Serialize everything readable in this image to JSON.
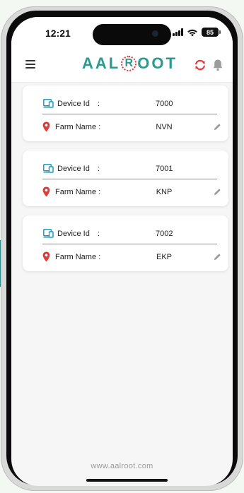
{
  "status_bar": {
    "time": "12:21",
    "battery": "85"
  },
  "header": {
    "logo_text_left": "AAL",
    "logo_ring_letter": "R",
    "logo_text_right": "OOT",
    "menu_icon": "hamburger-menu-icon",
    "refresh_icon": "refresh-icon",
    "bell_icon": "bell-icon"
  },
  "colors": {
    "brand_teal": "#2a9a8e",
    "accent_red": "#e53935",
    "pin_red": "#e53935",
    "device_icon_teal": "#1f9bbd"
  },
  "labels": {
    "device_id": "Device Id",
    "colon": ":",
    "farm_name": "Farm Name :"
  },
  "devices": [
    {
      "device_id": "7000",
      "farm_name": "NVN"
    },
    {
      "device_id": "7001",
      "farm_name": "KNP"
    },
    {
      "device_id": "7002",
      "farm_name": "EKP"
    }
  ],
  "footer": {
    "website": "www.aalroot.com"
  }
}
